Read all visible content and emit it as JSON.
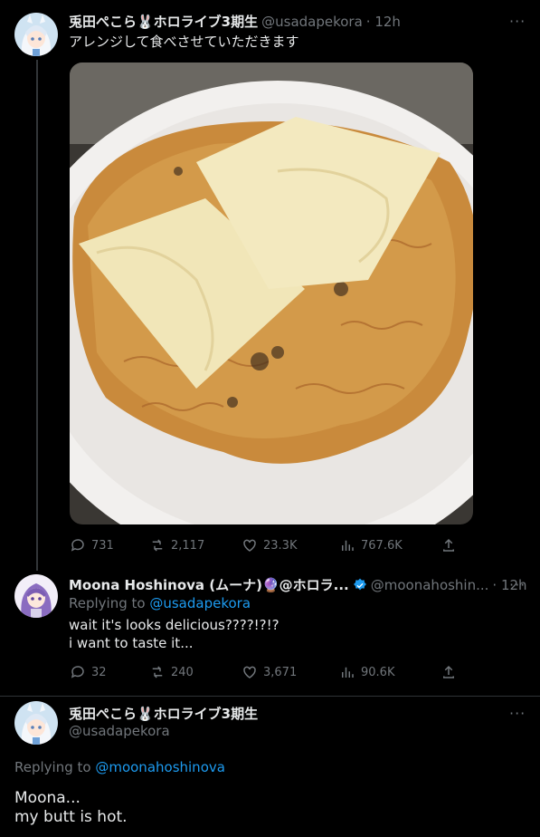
{
  "tweet1": {
    "name": "兎田ぺこら🐰ホロライブ3期生",
    "handle": "@usadapekora",
    "time": "· 12h",
    "text": "アレンジして食べさせていただきます",
    "stats": {
      "replies": "731",
      "retweets": "2,117",
      "likes": "23.3K",
      "views": "767.6K"
    },
    "more": "···"
  },
  "tweet2": {
    "name": "Moona Hoshinova (ムーナ)🔮@ホロラ...",
    "handle": "@moonahoshin...",
    "time": "· 12h",
    "replying_prefix": "Replying to ",
    "replying_to": "@usadapekora",
    "line1": "wait it's looks delicious????!?!?",
    "line2": "i want to taste it...",
    "stats": {
      "replies": "32",
      "retweets": "240",
      "likes": "3,671",
      "views": "90.6K"
    },
    "more": "···"
  },
  "tweet3": {
    "name": "兎田ぺこら🐰ホロライブ3期生",
    "handle": "@usadapekora",
    "replying_prefix": "Replying to ",
    "replying_to": "@moonahoshinova",
    "line1": "Moona...",
    "line2": "my butt is hot.",
    "more": "···"
  },
  "colors": {
    "accent": "#1d9bf0",
    "muted": "#71767b",
    "text": "#e7e9ea",
    "bg": "#000000"
  }
}
